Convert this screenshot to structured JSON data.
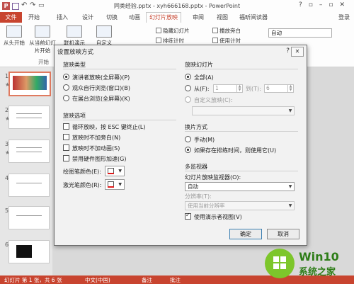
{
  "window": {
    "title": "同类经验.pptx - xyh666168.pptx - PowerPoint",
    "login": "登录"
  },
  "ribbon_tabs": {
    "file": "文件",
    "items": [
      "开始",
      "插入",
      "设计",
      "切换",
      "动画",
      "幻灯片放映",
      "审阅",
      "视图",
      "福昕阅读器"
    ],
    "active": "幻灯片放映"
  },
  "ribbon": {
    "btn_from_start": "从头开始",
    "btn_from_current": "从当前幻灯片开始",
    "btn_online": "联机演示",
    "btn_custom": "自定义",
    "group_start": "开始",
    "hide_slide": "隐藏幻灯片",
    "rehearse": "排练计时",
    "play_narration": "播放旁白",
    "use_timings": "使用计时",
    "monitor_value": "自动"
  },
  "slide_panel": {
    "numbers": [
      "1",
      "2",
      "3",
      "4",
      "5",
      "6"
    ]
  },
  "dialog": {
    "title": "设置放映方式",
    "help": "?",
    "close": "✕",
    "show_type": {
      "title": "放映类型",
      "options": [
        "演讲者放映(全屏幕)(P)",
        "观众自行浏览(窗口)(B)",
        "在展台浏览(全屏幕)(K)"
      ],
      "selected": 0
    },
    "show_options": {
      "title": "放映选项",
      "items": [
        {
          "label": "循环放映，按 ESC 键终止(L)",
          "checked": false
        },
        {
          "label": "放映时不加旁白(N)",
          "checked": false
        },
        {
          "label": "放映时不加动画(S)",
          "checked": false
        },
        {
          "label": "禁用硬件图形加速(G)",
          "checked": false
        }
      ],
      "pen_color_label": "绘图笔颜色(E):",
      "laser_color_label": "激光笔颜色(R):",
      "pen_color": "#e01b1b",
      "laser_color": "#e01b1b"
    },
    "show_slides": {
      "title": "放映幻灯片",
      "all": "全部(A)",
      "from": "从(F):",
      "from_value": "1",
      "to": "到(T):",
      "to_value": "6",
      "custom": "自定义放映(C):",
      "selected": "all"
    },
    "advance": {
      "title": "换片方式",
      "manual": "手动(M)",
      "timings": "如果存在排练时间，则使用它(U)",
      "selected": "timings"
    },
    "monitors": {
      "title": "多监视器",
      "monitor_label": "幻灯片放映监视器(O):",
      "monitor_value": "自动",
      "resolution_label": "分辨率(T):",
      "resolution_value": "使用当前分辨率",
      "presenter_view": "使用演示者视图(V)",
      "presenter_checked": true
    },
    "ok": "确定",
    "cancel": "取消"
  },
  "statusbar": {
    "slide_info": "幻灯片 第 1 张，共 6 张",
    "language": "中文(中国)",
    "notes": "备注",
    "comments": "批注"
  },
  "watermark": {
    "line1": "Win10",
    "line2": "系统之家"
  }
}
